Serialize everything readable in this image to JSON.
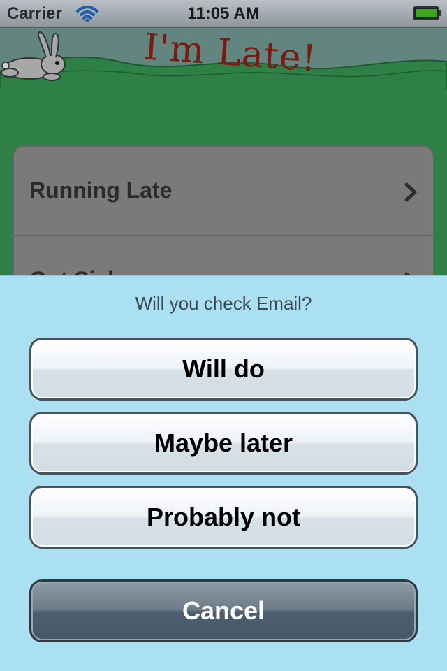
{
  "status_bar": {
    "carrier": "Carrier",
    "time": "11:05 AM",
    "wifi_icon": "wifi-icon",
    "battery_icon": "battery-full-icon",
    "battery_color": "#3aa81e"
  },
  "header": {
    "title": "I'm Late!",
    "logo_icon": "rabbit-icon",
    "title_color": "#7a1a12",
    "background_color": "#62857f",
    "hill_color": "#2e8046"
  },
  "table": {
    "rows": [
      {
        "label": "Running Late",
        "accessory": "chevron-right-icon"
      },
      {
        "label": "Got Sick",
        "accessory": "chevron-right-icon"
      }
    ]
  },
  "action_sheet": {
    "title": "Will you check Email?",
    "buttons": [
      {
        "label": "Will do"
      },
      {
        "label": "Maybe later"
      },
      {
        "label": "Probably not"
      }
    ],
    "cancel_label": "Cancel",
    "background_color": "#abdff2"
  }
}
